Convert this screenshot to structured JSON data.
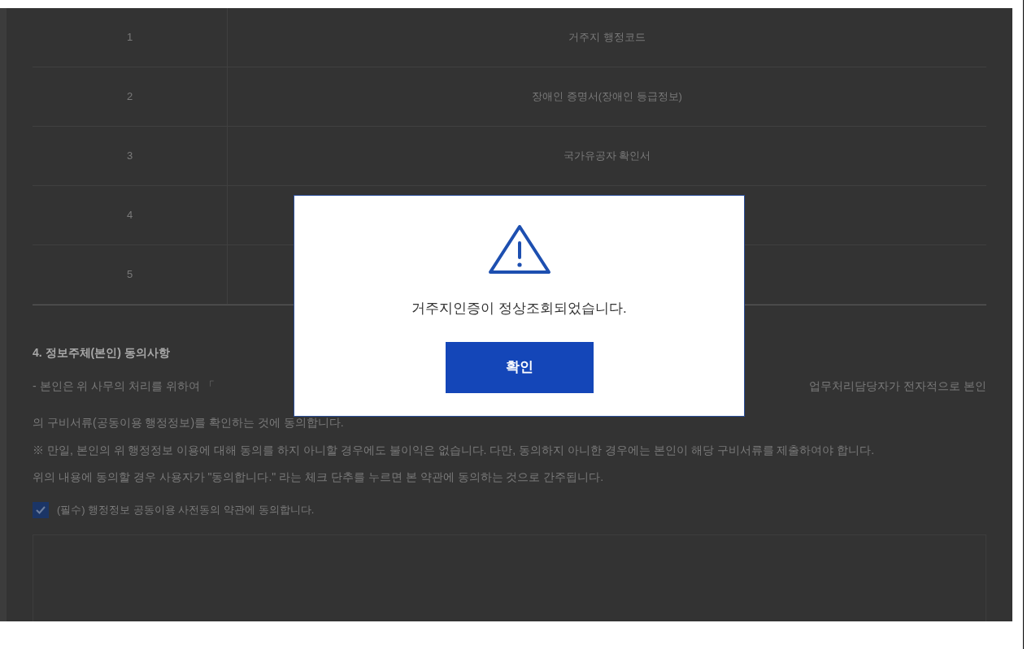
{
  "table": {
    "rows": [
      {
        "no": "1",
        "name": "거주지 행정코드"
      },
      {
        "no": "2",
        "name": "장애인 증명서(장애인 등급정보)"
      },
      {
        "no": "3",
        "name": "국가유공자 확인서"
      },
      {
        "no": "4"
      },
      {
        "no": "5"
      }
    ]
  },
  "consent": {
    "heading": "4. 정보주체(본인) 동의사항",
    "line1_left": "- 본인은 위 사무의 처리를 위하여 「",
    "line1_right": "업무처리담당자가 전자적으로 본인",
    "line2": "의 구비서류(공동이용 행정정보)를 확인하는 것에 동의합니다.",
    "notice": "※ 만일, 본인의 위 행정정보 이용에 대해 동의를 하지 아니할 경우에도 불이익은 없습니다. 다만, 동의하지 아니한 경우에는 본인이 해당 구비서류를 제출하여야 합니다.",
    "guide": "위의 내용에 동의할 경우 사용자가 \"동의합니다.\" 라는 체크 단추를 누르면 본 약관에 동의하는 것으로 간주됩니다.",
    "agree": {
      "label": "(필수) 행정정보 공동이용 사전동의 약관에 동의합니다.",
      "checked": true
    }
  },
  "dialog": {
    "message": "거주지인증이 정상조회되었습니다.",
    "button": "확인"
  }
}
